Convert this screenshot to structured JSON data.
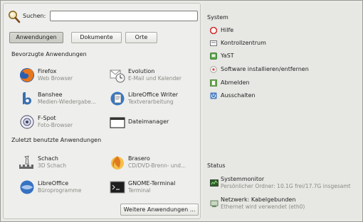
{
  "search": {
    "label": "Suchen:",
    "value": ""
  },
  "tabs": [
    {
      "label": "Anwendungen",
      "active": true
    },
    {
      "label": "Dokumente",
      "active": false
    },
    {
      "label": "Orte",
      "active": false
    }
  ],
  "favorites": {
    "title": "Bevorzugte Anwendungen",
    "apps": [
      {
        "name": "Firefox",
        "desc": "Web Browser",
        "icon": "firefox-icon"
      },
      {
        "name": "Evolution",
        "desc": "E-Mail und Kalender",
        "icon": "evolution-icon"
      },
      {
        "name": "Banshee",
        "desc": "Medien-Wiedergabe...",
        "icon": "banshee-icon"
      },
      {
        "name": "LibreOffice Writer",
        "desc": "Textverarbeitung",
        "icon": "writer-icon"
      },
      {
        "name": "F-Spot",
        "desc": "Foto-Browser",
        "icon": "fspot-icon"
      },
      {
        "name": "Dateimanager",
        "desc": "",
        "icon": "file-manager-icon"
      }
    ]
  },
  "recent": {
    "title": "Zuletzt benutzte Anwendungen",
    "apps": [
      {
        "name": "Schach",
        "desc": "3D Schach",
        "icon": "chess-icon"
      },
      {
        "name": "Brasero",
        "desc": "CD/DVD-Brenn- und...",
        "icon": "brasero-icon"
      },
      {
        "name": "LibreOffice",
        "desc": "Büroprogramme",
        "icon": "libreoffice-icon"
      },
      {
        "name": "GNOME-Terminal",
        "desc": "Terminal",
        "icon": "terminal-icon"
      }
    ]
  },
  "more_button": "Weitere Anwendungen ...",
  "system": {
    "title": "System",
    "items": [
      {
        "label": "Hilfe",
        "icon": "help-icon"
      },
      {
        "label": "Kontrollzentrum",
        "icon": "control-center-icon"
      },
      {
        "label": "YaST",
        "icon": "yast-icon"
      },
      {
        "label": "Software installieren/entfernen",
        "icon": "software-icon"
      },
      {
        "label": "Abmelden",
        "icon": "logout-icon"
      },
      {
        "label": "Ausschalten",
        "icon": "power-icon"
      }
    ]
  },
  "status": {
    "title": "Status",
    "items": [
      {
        "name": "Systemmonitor",
        "desc": "Persönlicher Ordner: 10.1G frei/17.7G insgesamt",
        "icon": "system-monitor-icon"
      },
      {
        "name": "Netzwerk: Kabelgebunden",
        "desc": "Ethernet wird verwendet (eth0)",
        "icon": "network-icon"
      }
    ]
  }
}
